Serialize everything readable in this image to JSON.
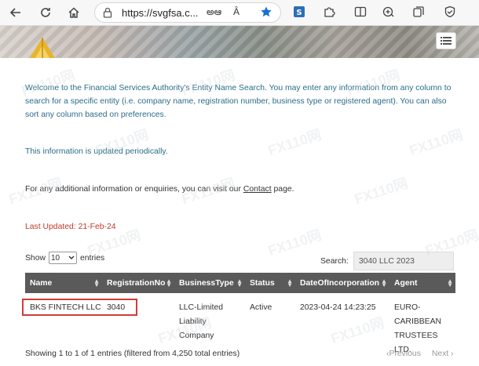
{
  "browser": {
    "url": "https://svgfsa.c...",
    "read_aloud_label": "Ȃ",
    "translate_label": "అఆ"
  },
  "intro_text": "Welcome to the Financial Services Authority's Entity Name Search. You may enter any information from any column to search for a specific entity (i.e. company name, registration number, business type or registered agent). You can also sort any column based on preferences.",
  "updated_info": "This information is updated periodically.",
  "contact": {
    "prefix": "For any additional information or enquiries, you can visit our ",
    "link": "Contact",
    "suffix": " page."
  },
  "last_updated": "Last Updated:  21-Feb-24",
  "controls": {
    "show_label": "Show",
    "entries_value": "10",
    "entries_label": "entries",
    "search_label": "Search:",
    "search_value": "3040 LLC 2023"
  },
  "table": {
    "columns": [
      "Name",
      "RegistrationNo",
      "BusinessType",
      "Status",
      "DateOfIncorporation",
      "Agent"
    ],
    "row": {
      "name": "BKS FINTECH LLC",
      "registration_no": "3040",
      "business_type": [
        "LLC-Limited",
        "Liability",
        "Company"
      ],
      "status": "Active",
      "date": "2023-04-24 14:23:25",
      "agent": [
        "EURO-",
        "CARIBBEAN",
        "TRUSTEES LTD."
      ]
    }
  },
  "footer": {
    "info": "Showing 1 to 1 of 1 entries (filtered from 4,250 total entries)",
    "previous": "Previous",
    "next": "Next"
  },
  "watermark": "FX110网",
  "colors": {
    "header_bg": "#5a5a5a",
    "link_text": "#2b6d8a",
    "alert_red": "#c0392b",
    "highlight_border": "#d23b3b"
  }
}
